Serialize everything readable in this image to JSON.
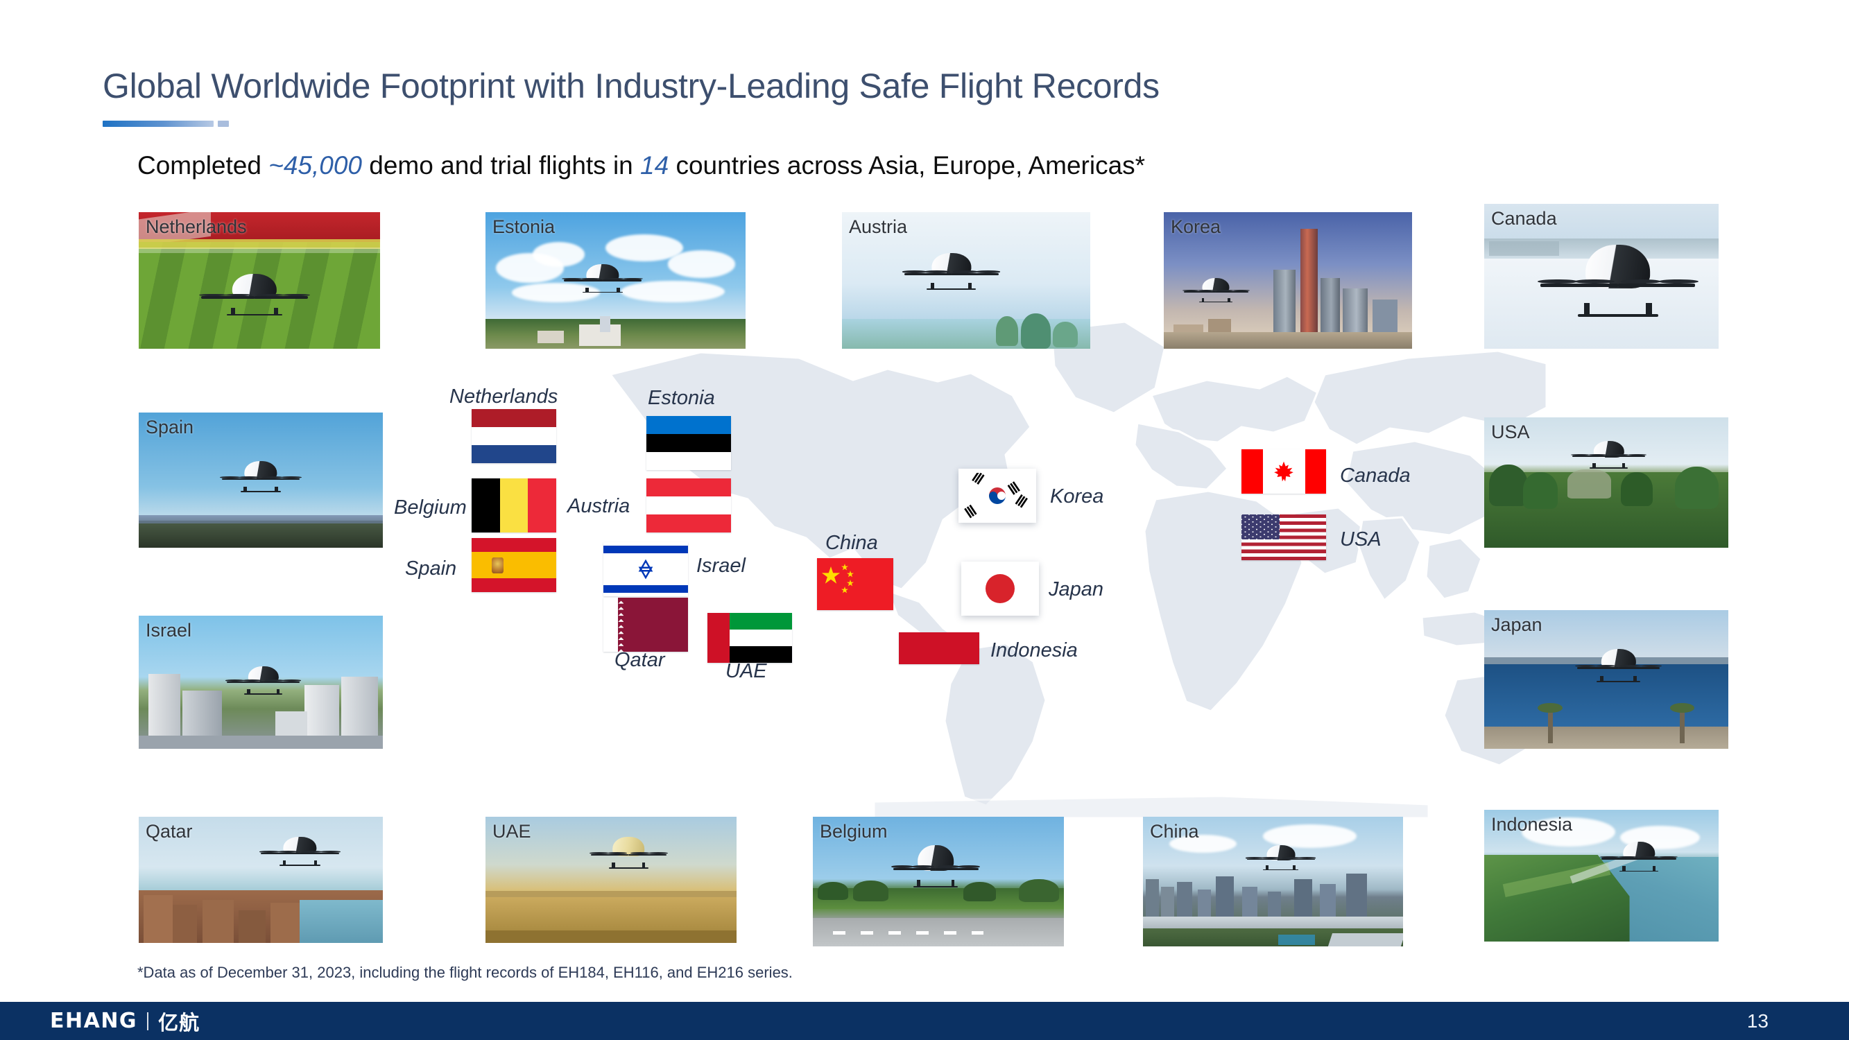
{
  "slide": {
    "page_number": "13",
    "background_color": "#ffffff"
  },
  "header": {
    "title": "Global Worldwide Footprint with Industry-Leading Safe Flight Records",
    "title_color": "#3d4f6e",
    "accent_gradient_from": "#1e72c4",
    "accent_gradient_to": "#b7c9e4"
  },
  "subtitle": {
    "part1": "Completed ",
    "highlight1": "~45,000",
    "part2": " demo and trial flights in ",
    "highlight2": "14",
    "part3": " countries across Asia, Europe, Americas*",
    "highlight_color": "#2e5fa8"
  },
  "footnote": {
    "text": "*Data as of December 31, 2023, including the flight records of EH184, EH116, and EH216 series."
  },
  "footer": {
    "logo_wordmark": "EHANG",
    "logo_cjk": "亿航",
    "background_color": "#0b3163"
  },
  "map": {
    "land_color": "#e3e8ef",
    "border_color": "#ffffff"
  },
  "photos": {
    "top_row": [
      {
        "caption": "Netherlands"
      },
      {
        "caption": "Estonia"
      },
      {
        "caption": "Austria"
      },
      {
        "caption": "Korea"
      },
      {
        "caption": "Canada"
      }
    ],
    "left_column": [
      {
        "caption": "Spain"
      },
      {
        "caption": "Israel"
      }
    ],
    "right_column": [
      {
        "caption": "USA"
      },
      {
        "caption": "Japan"
      }
    ],
    "bottom_row": [
      {
        "caption": "Qatar"
      },
      {
        "caption": "UAE"
      },
      {
        "caption": "Belgium"
      },
      {
        "caption": "China"
      },
      {
        "caption": "Indonesia"
      }
    ]
  },
  "flags": {
    "europe": [
      {
        "country": "Netherlands",
        "label_position": "above"
      },
      {
        "country": "Belgium",
        "label_position": "left"
      },
      {
        "country": "Spain",
        "label_position": "left"
      },
      {
        "country": "Estonia",
        "label_position": "above"
      },
      {
        "country": "Austria",
        "label_position": "left"
      },
      {
        "country": "Israel",
        "label_position": "right"
      },
      {
        "country": "Qatar",
        "label_position": "below"
      },
      {
        "country": "UAE",
        "label_position": "below"
      }
    ],
    "asia": [
      {
        "country": "China",
        "label_position": "above"
      },
      {
        "country": "Korea",
        "label_position": "right"
      },
      {
        "country": "Japan",
        "label_position": "right"
      },
      {
        "country": "Indonesia",
        "label_position": "right"
      }
    ],
    "americas": [
      {
        "country": "Canada",
        "label_position": "right"
      },
      {
        "country": "USA",
        "label_position": "right"
      }
    ]
  },
  "flag_labels": {
    "netherlands": "Netherlands",
    "belgium": "Belgium",
    "spain": "Spain",
    "estonia": "Estonia",
    "austria": "Austria",
    "israel": "Israel",
    "qatar": "Qatar",
    "uae": "UAE",
    "china": "China",
    "korea": "Korea",
    "japan": "Japan",
    "indonesia": "Indonesia",
    "canada": "Canada",
    "usa": "USA"
  },
  "flag_colors": {
    "netherlands_red": "#AE1C28",
    "netherlands_white": "#FFFFFF",
    "netherlands_blue": "#21468B",
    "belgium_black": "#000000",
    "belgium_yellow": "#FAE042",
    "belgium_red": "#ED2939",
    "spain_red": "#D4142A",
    "spain_yellow": "#FABD00",
    "estonia_blue": "#0072CE",
    "estonia_black": "#000000",
    "estonia_white": "#FFFFFF",
    "austria_red": "#ED2939",
    "israel_blue": "#0038B8",
    "qatar_maroon": "#8A1538",
    "uae_red": "#CE1126",
    "uae_green": "#009739",
    "uae_black": "#000000",
    "china_red": "#EE1C25",
    "china_yellow": "#FFDE00",
    "korea_red": "#CD2E3A",
    "korea_blue": "#0047A0",
    "japan_red": "#D8232B",
    "indonesia_red": "#CE1126",
    "canada_red": "#FF0000",
    "usa_blue": "#3C3B6E",
    "usa_red": "#B22234"
  }
}
